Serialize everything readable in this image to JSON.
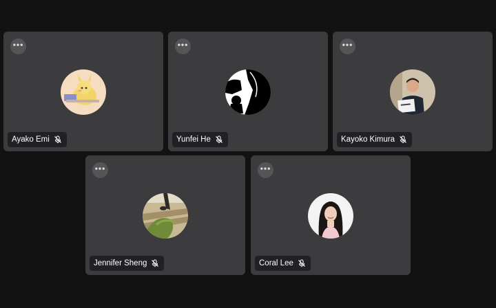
{
  "participants": [
    {
      "name": "Ayako Emi",
      "muted": true,
      "avatar": "cartoon-character-photo"
    },
    {
      "name": "Yunfei He",
      "muted": true,
      "avatar": "black-white-silhouette-photo"
    },
    {
      "name": "Kayoko Kimura",
      "muted": true,
      "avatar": "person-holding-sign-photo"
    },
    {
      "name": "Jennifer Sheng",
      "muted": true,
      "avatar": "stairs-and-plants-photo"
    },
    {
      "name": "Coral Lee",
      "muted": true,
      "avatar": "smiling-woman-photo"
    }
  ],
  "more_options_label": "•••",
  "colors": {
    "background": "#121212",
    "tile": "#3c3c3f",
    "nameplate": "#202124"
  }
}
